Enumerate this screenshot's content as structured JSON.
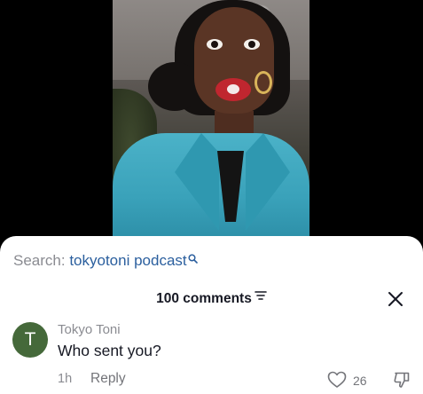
{
  "video": {
    "description_icons": []
  },
  "search_suggestion": {
    "prefix": "Search:",
    "term": "tokyotoni podcast",
    "icon": "search-icon"
  },
  "comments": {
    "header": "100 comments",
    "filter_icon": "filter-icon",
    "close_icon": "close-icon",
    "items": [
      {
        "avatar_letter": "T",
        "avatar_color": "#45693a",
        "author": "Tokyo Toni",
        "text": "Who sent you?",
        "time": "1h",
        "reply_label": "Reply",
        "likes": "26"
      }
    ]
  }
}
